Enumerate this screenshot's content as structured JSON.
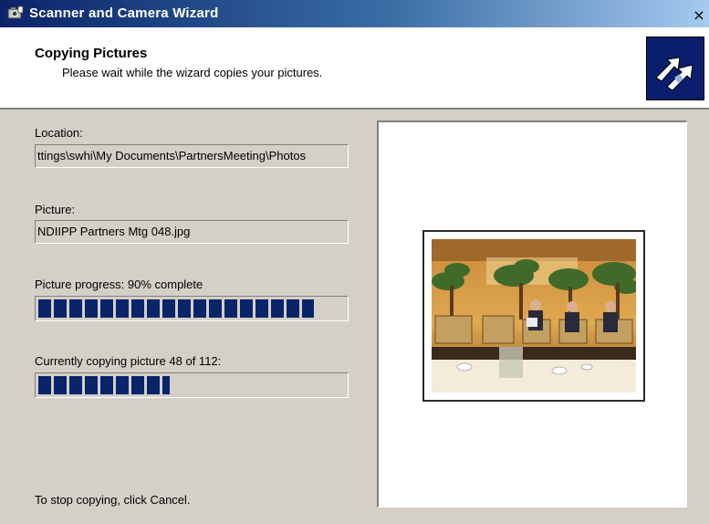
{
  "window": {
    "title": "Scanner and Camera Wizard",
    "close_glyph": "×"
  },
  "header": {
    "title": "Copying Pictures",
    "subtitle": "Please wait while the wizard copies your pictures."
  },
  "location": {
    "label": "Location:",
    "value": "ttings\\swhi\\My Documents\\PartnersMeeting\\Photos"
  },
  "picture": {
    "label": "Picture:",
    "value": "NDIIPP Partners Mtg 048.jpg"
  },
  "picture_progress": {
    "label": "Picture progress: 90% complete",
    "percent": 90
  },
  "overall_progress": {
    "label": "Currently copying picture 48 of 112:",
    "current": 48,
    "total": 112
  },
  "footer": {
    "hint": "To stop copying, click Cancel."
  },
  "icons": {
    "title_icon": "camera-wizard-icon",
    "header_logo": "wizard-arrows-icon",
    "preview": "photo-thumbnail"
  },
  "colors": {
    "title_bar_start": "#0a246a",
    "title_bar_end": "#a6caf0",
    "progress_fill": "#0a246a",
    "dialog_bg": "#d4d0c8"
  }
}
